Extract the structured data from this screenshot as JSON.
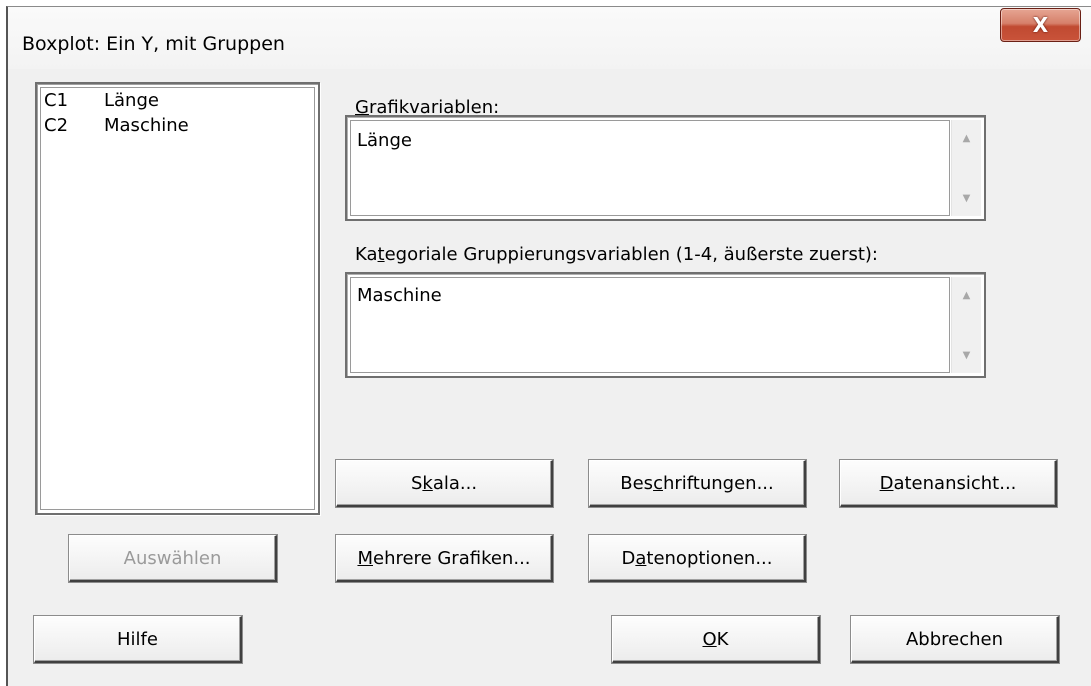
{
  "window": {
    "title": "Boxplot: Ein Y, mit Gruppen",
    "close_symbol": "X"
  },
  "variables": [
    {
      "column": "C1",
      "name": "Länge"
    },
    {
      "column": "C2",
      "name": "Maschine"
    }
  ],
  "graph_vars": {
    "label_pre": "",
    "label_key": "G",
    "label_post": "rafikvariablen:",
    "value": "Länge"
  },
  "group_vars": {
    "label_pre": "Ka",
    "label_key": "t",
    "label_post": "egoriale Gruppierungsvariablen (1-4, äußerste zuerst):",
    "value": "Maschine"
  },
  "buttons": {
    "scale": {
      "pre": "S",
      "key": "k",
      "post": "ala..."
    },
    "labels": {
      "pre": "Bes",
      "key": "c",
      "post": "hriftungen..."
    },
    "data_view": {
      "pre": "",
      "key": "D",
      "post": "atenansicht..."
    },
    "select": {
      "label": "Auswählen"
    },
    "multiple_graphs": {
      "pre": "",
      "key": "M",
      "post": "ehrere Grafiken..."
    },
    "data_options": {
      "pre": "D",
      "key": "a",
      "post": "tenoptionen..."
    },
    "help": {
      "label": "Hilfe"
    },
    "ok": {
      "pre": "",
      "key": "O",
      "post": "K"
    },
    "cancel": {
      "label": "Abbrechen"
    }
  },
  "icons": {
    "scroll_up": "scroll-up-icon",
    "scroll_down": "scroll-down-icon",
    "close": "close-icon"
  }
}
